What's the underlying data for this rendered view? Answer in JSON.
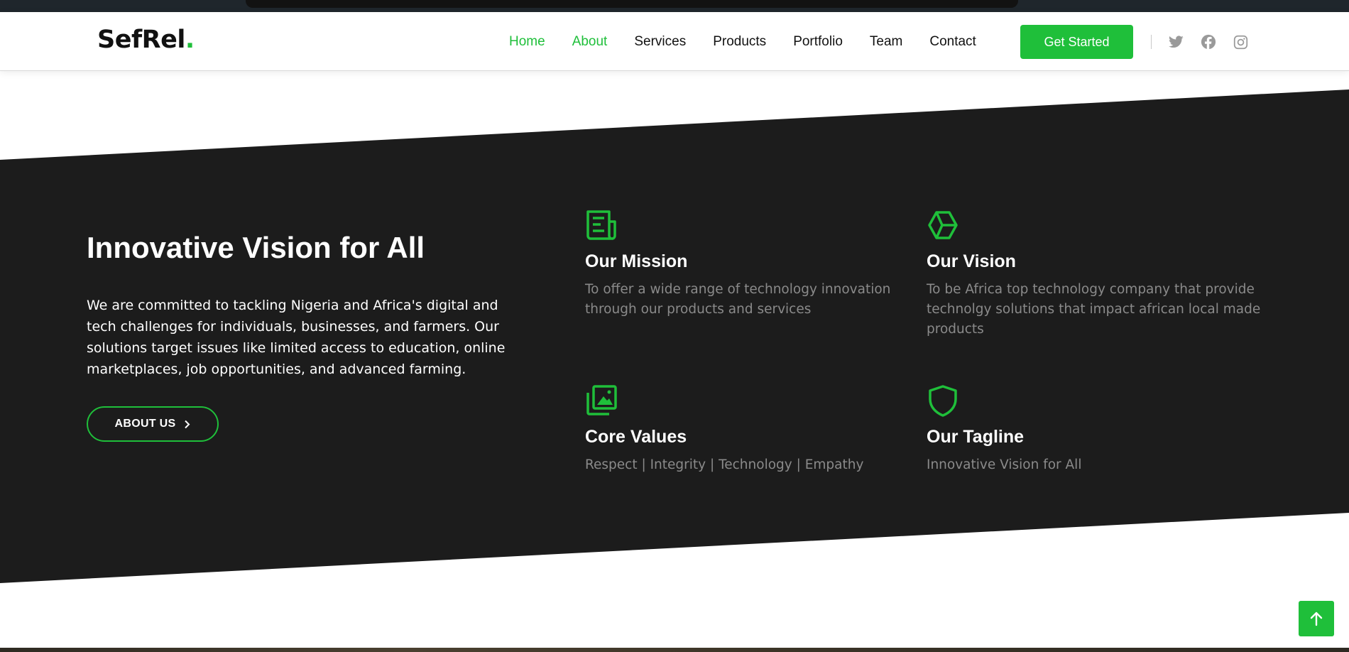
{
  "header": {
    "logo_text": "SefRel",
    "logo_dot": ".",
    "nav": [
      {
        "label": "Home",
        "active": true
      },
      {
        "label": "About",
        "active": true
      },
      {
        "label": "Services",
        "active": false
      },
      {
        "label": "Products",
        "active": false
      },
      {
        "label": "Portfolio",
        "active": false
      },
      {
        "label": "Team",
        "active": false
      },
      {
        "label": "Contact",
        "active": false
      }
    ],
    "cta_label": "Get Started",
    "social_icons": [
      "twitter-icon",
      "facebook-icon",
      "instagram-icon"
    ]
  },
  "about": {
    "title": "Innovative Vision for All",
    "description": "We are committed to tackling Nigeria and Africa's digital and tech challenges for individuals, businesses, and farmers. Our solutions target issues like limited access to education, online marketplaces, job opportunities, and advanced farming.",
    "button_label": "ABOUT US",
    "cards": [
      {
        "icon": "newspaper-icon",
        "title": "Our Mission",
        "text": "To offer a wide range of technology innovation through our products and services"
      },
      {
        "icon": "box-icon",
        "title": "Our Vision",
        "text": "To be Africa top technology company that provide technolgy solutions that impact african local made products"
      },
      {
        "icon": "images-icon",
        "title": "Core Values",
        "text": "Respect | Integrity | Technology | Empathy"
      },
      {
        "icon": "shield-icon",
        "title": "Our Tagline",
        "text": "Innovative Vision for All"
      }
    ]
  },
  "colors": {
    "accent": "#1fbf3a",
    "dark_bg": "#1c1c1c",
    "muted_text": "#8a8a8a"
  }
}
